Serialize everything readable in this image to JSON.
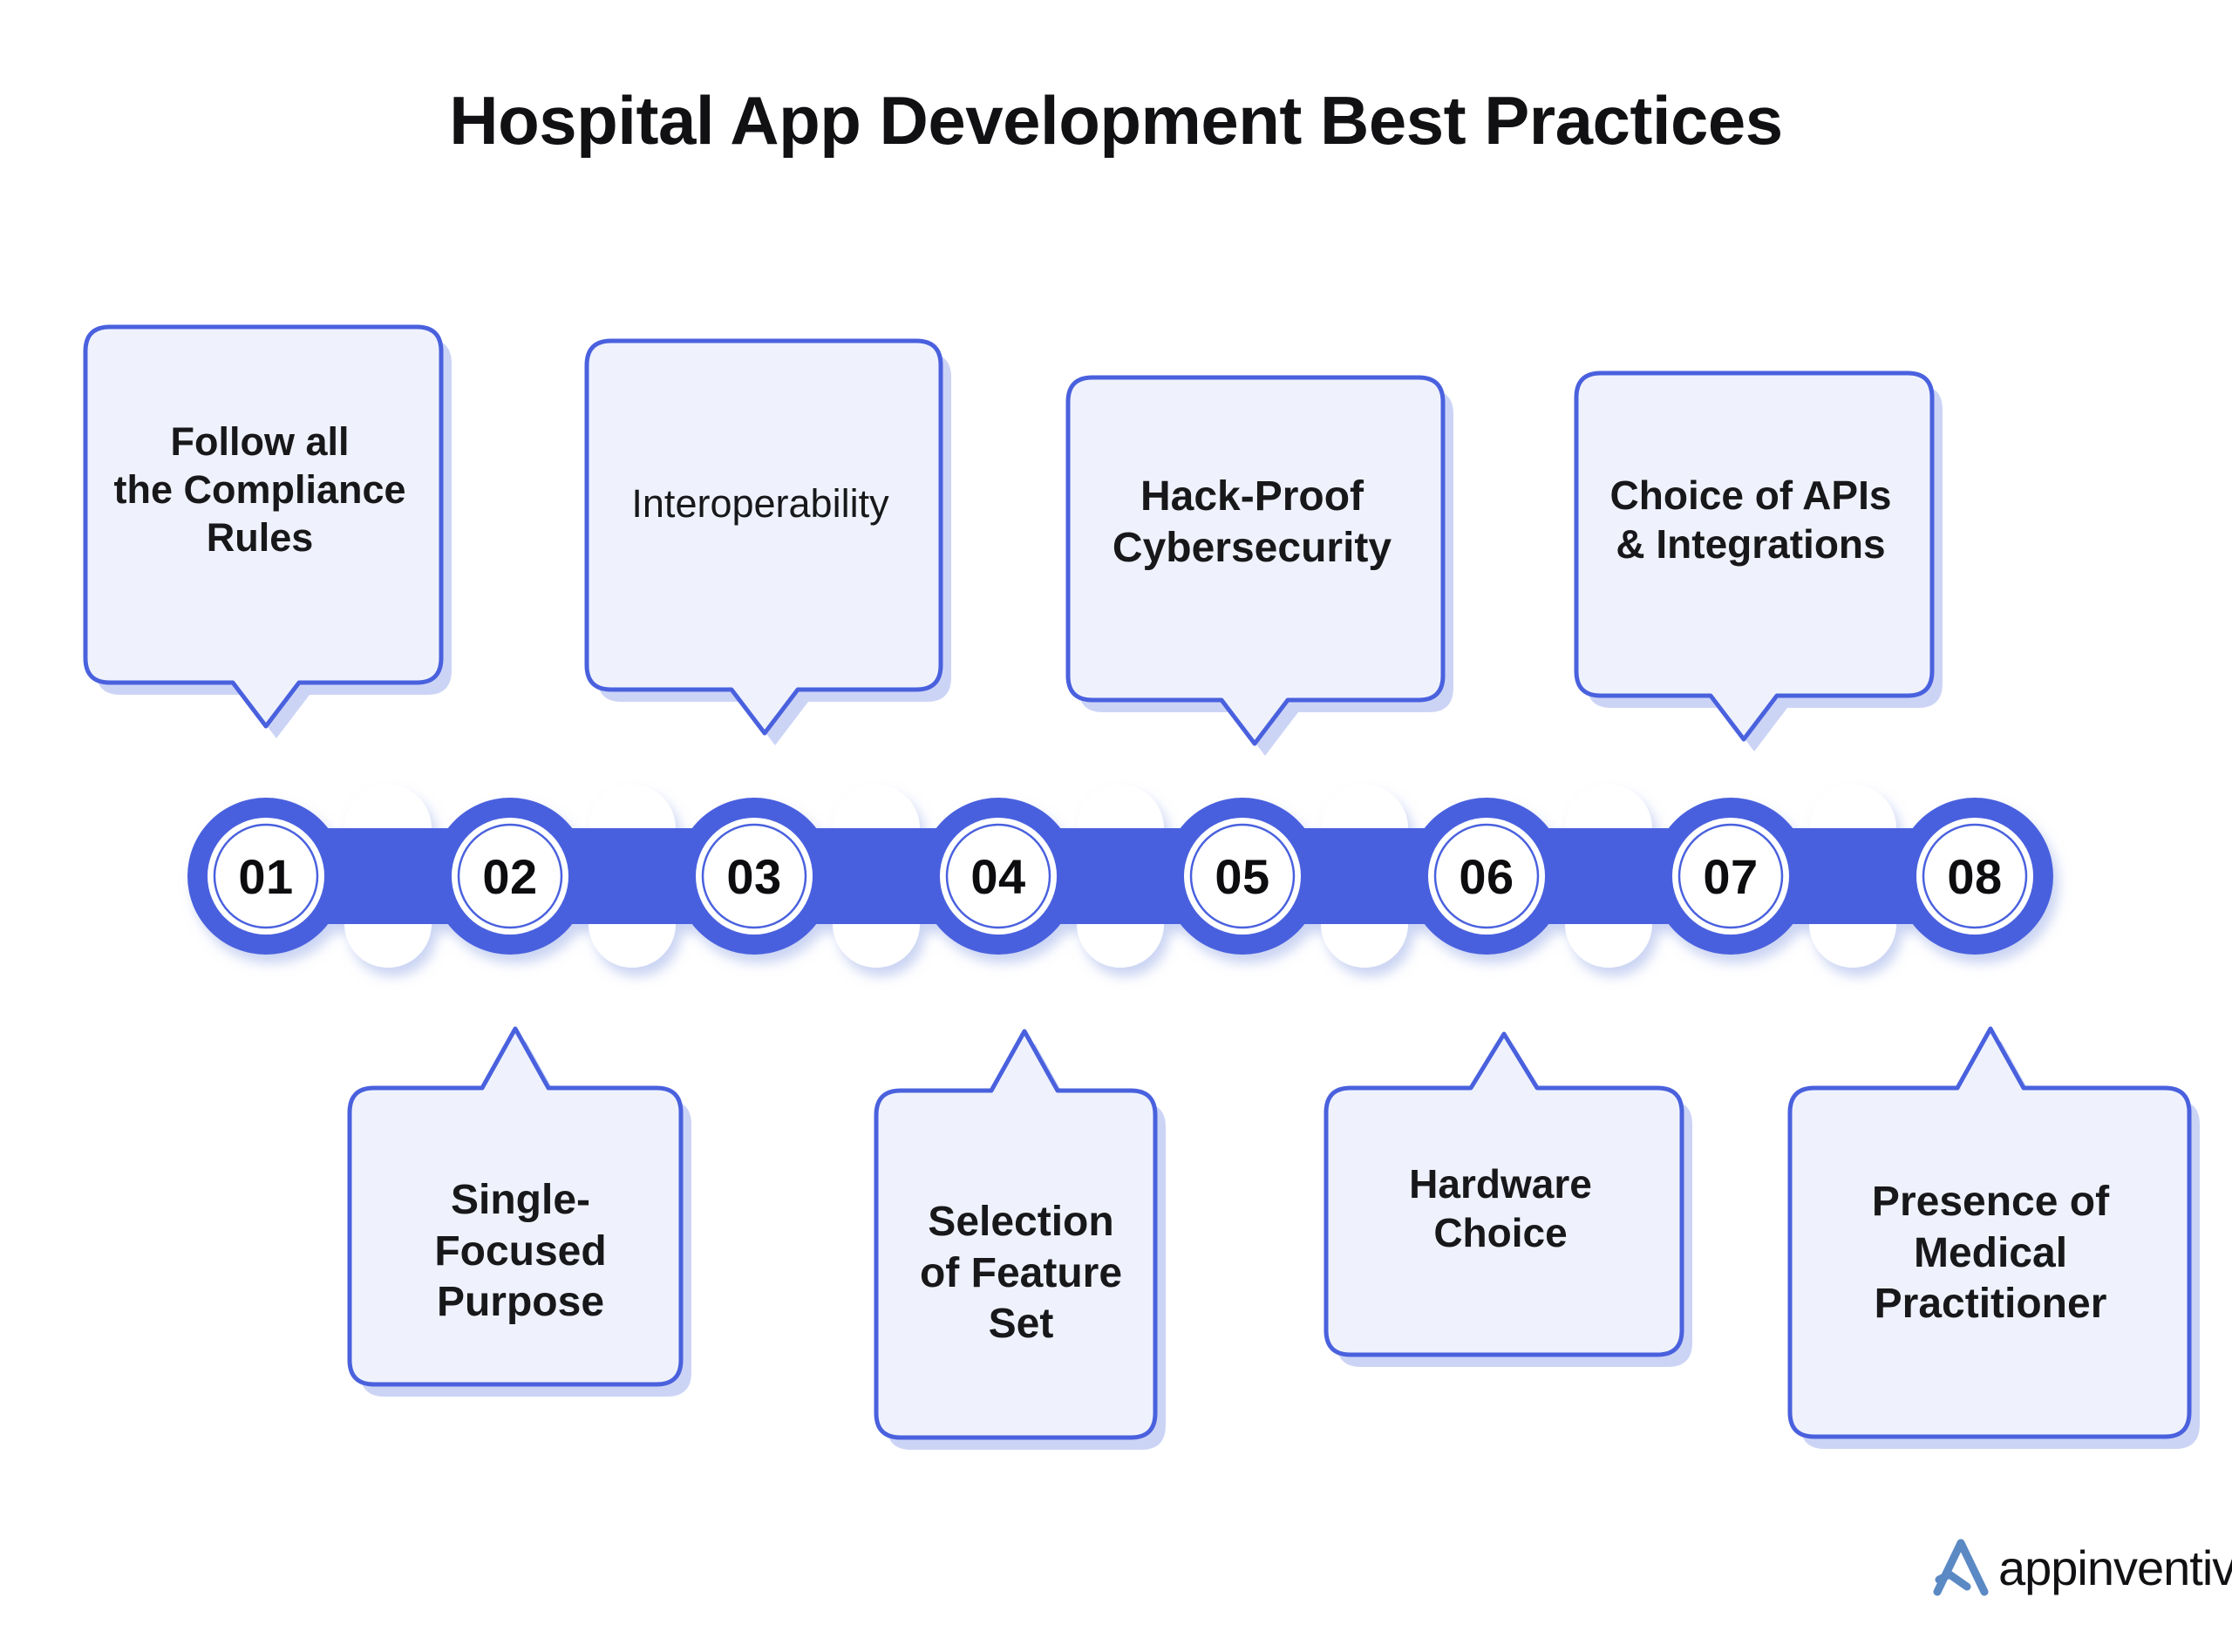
{
  "title": "Hospital App Development Best Practices",
  "theme": {
    "accent_blue": "#4A61DE",
    "box_fill": "#EFF2FC",
    "box_shadow": "#C9D2F5",
    "text_dark": "#18181b",
    "logo_blue": "#5B89C4"
  },
  "steps": [
    {
      "number": "01",
      "label": "Follow all\nthe Compliance\nRules",
      "position": "top"
    },
    {
      "number": "02",
      "label": "Single-\nFocused\nPurpose",
      "position": "bottom"
    },
    {
      "number": "03",
      "label": "Interoperability",
      "position": "top"
    },
    {
      "number": "04",
      "label": "Selection\nof Feature\nSet",
      "position": "bottom"
    },
    {
      "number": "05",
      "label": "Hack-Proof\nCybersecurity",
      "position": "top"
    },
    {
      "number": "06",
      "label": "Hardware\nChoice",
      "position": "bottom"
    },
    {
      "number": "07",
      "label": "Choice of APIs\n& Integrations",
      "position": "top"
    },
    {
      "number": "08",
      "label": "Presence of\nMedical\nPractitioner",
      "position": "bottom"
    }
  ],
  "top_boxes": [
    {
      "text": "Follow all\nthe Compliance\nRules"
    },
    {
      "text": "Interoperability"
    },
    {
      "text": "Hack-Proof\nCybersecurity"
    },
    {
      "text": "Choice of APIs\n& Integrations"
    }
  ],
  "bottom_boxes": [
    {
      "text": "Single-\nFocused\nPurpose"
    },
    {
      "text": "Selection\nof Feature\nSet"
    },
    {
      "text": "Hardware\nChoice"
    },
    {
      "text": "Presence of\nMedical\nPractitioner"
    }
  ],
  "logo": {
    "wordmark": "appinventiv"
  }
}
